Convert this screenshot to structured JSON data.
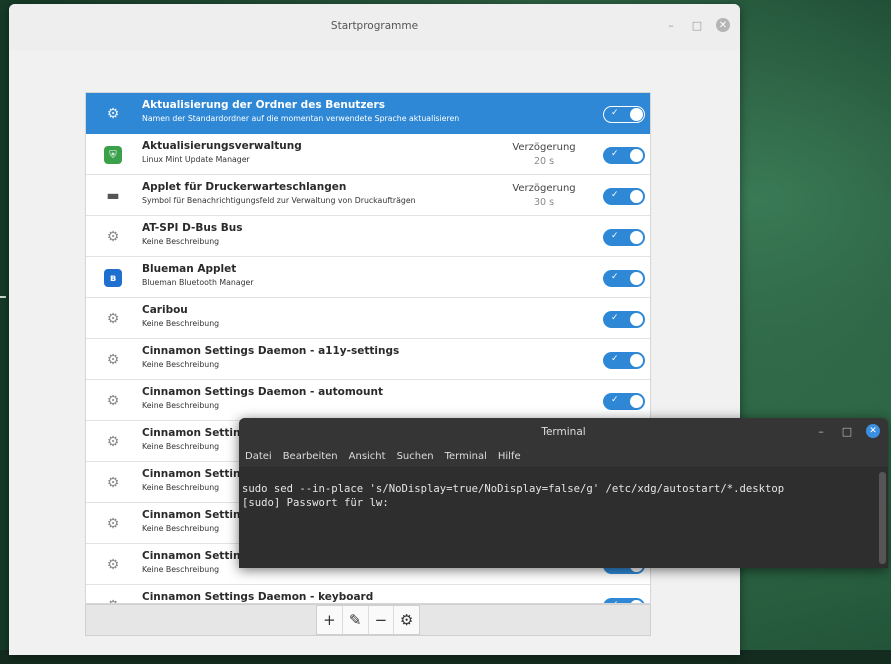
{
  "startup_window": {
    "title": "Startprogramme",
    "controls": {
      "minimize": "–",
      "maximize": "□",
      "close": "✕"
    },
    "items": [
      {
        "name": "Aktualisierung der Ordner des Benutzers",
        "description": "Namen der Standardordner auf die momentan verwendete Sprache aktualisieren",
        "icon": "gears-icon",
        "delay_label": "",
        "delay_value": "",
        "enabled": true,
        "selected": true
      },
      {
        "name": "Aktualisierungsverwaltung",
        "description": "Linux Mint Update Manager",
        "icon": "shield-icon",
        "delay_label": "Verzögerung",
        "delay_value": "20 s",
        "enabled": true,
        "selected": false
      },
      {
        "name": "Applet für Druckerwarteschlangen",
        "description": "Symbol für Benachrichtigungsfeld zur Verwaltung von Druckaufträgen",
        "icon": "printer-icon",
        "delay_label": "Verzögerung",
        "delay_value": "30 s",
        "enabled": true,
        "selected": false
      },
      {
        "name": "AT-SPI D-Bus Bus",
        "description": "Keine Beschreibung",
        "icon": "gears-icon",
        "delay_label": "",
        "delay_value": "",
        "enabled": true,
        "selected": false
      },
      {
        "name": "Blueman Applet",
        "description": "Blueman Bluetooth Manager",
        "icon": "bluetooth-icon",
        "delay_label": "",
        "delay_value": "",
        "enabled": true,
        "selected": false
      },
      {
        "name": "Caribou",
        "description": "Keine Beschreibung",
        "icon": "gears-icon",
        "delay_label": "",
        "delay_value": "",
        "enabled": true,
        "selected": false
      },
      {
        "name": "Cinnamon Settings Daemon - a11y-settings",
        "description": "Keine Beschreibung",
        "icon": "gears-icon",
        "delay_label": "",
        "delay_value": "",
        "enabled": true,
        "selected": false
      },
      {
        "name": "Cinnamon Settings Daemon - automount",
        "description": "Keine Beschreibung",
        "icon": "gears-icon",
        "delay_label": "",
        "delay_value": "",
        "enabled": true,
        "selected": false
      },
      {
        "name": "Cinnamon Setting",
        "description": "Keine Beschreibung",
        "icon": "gears-icon",
        "delay_label": "",
        "delay_value": "",
        "enabled": true,
        "selected": false
      },
      {
        "name": "Cinnamon Setting",
        "description": "Keine Beschreibung",
        "icon": "gears-icon",
        "delay_label": "",
        "delay_value": "",
        "enabled": true,
        "selected": false
      },
      {
        "name": "Cinnamon Setting",
        "description": "Keine Beschreibung",
        "icon": "gears-icon",
        "delay_label": "",
        "delay_value": "",
        "enabled": true,
        "selected": false
      },
      {
        "name": "Cinnamon Setting",
        "description": "Keine Beschreibung",
        "icon": "gears-icon",
        "delay_label": "",
        "delay_value": "",
        "enabled": true,
        "selected": false
      },
      {
        "name": "Cinnamon Settings Daemon - keyboard",
        "description": "",
        "icon": "gears-icon",
        "delay_label": "",
        "delay_value": "",
        "enabled": true,
        "selected": false
      }
    ],
    "toolbar": {
      "add": "+",
      "edit": "✎",
      "remove": "−",
      "run": "⚙"
    }
  },
  "terminal": {
    "title": "Terminal",
    "controls": {
      "minimize": "–",
      "maximize": "□",
      "close": "✕"
    },
    "menu": [
      "Datei",
      "Bearbeiten",
      "Ansicht",
      "Suchen",
      "Terminal",
      "Hilfe"
    ],
    "lines": [
      "sudo sed --in-place 's/NoDisplay=true/NoDisplay=false/g' /etc/xdg/autostart/*.desktop",
      "[sudo] Passwort für lw:"
    ]
  },
  "colors": {
    "accent": "#2f88d6",
    "terminal_bg": "#2e2e2e"
  }
}
